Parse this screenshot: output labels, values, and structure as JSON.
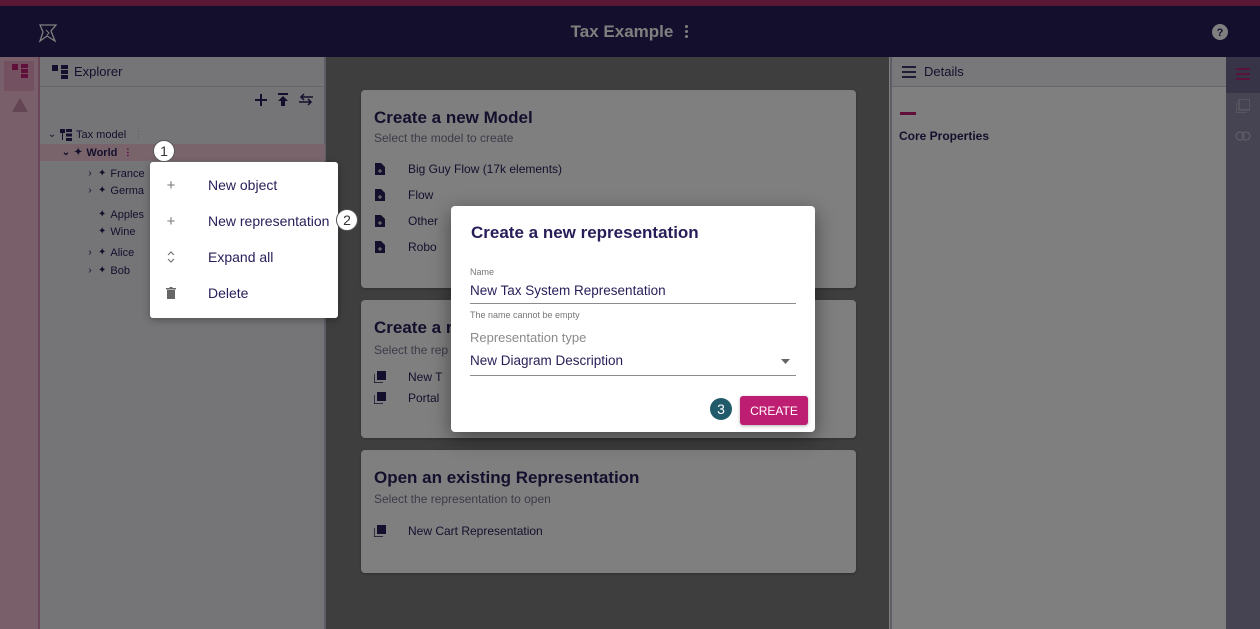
{
  "app": {
    "title": "Tax Example",
    "accent": "#be1e72",
    "header_bg": "#261e58"
  },
  "explorer": {
    "title": "Explorer",
    "tree": [
      {
        "label": "Tax model",
        "level": 0
      },
      {
        "label": "World",
        "level": 1,
        "selected": true
      },
      {
        "label": "France",
        "level": 2
      },
      {
        "label": "Germa",
        "level": 2
      },
      {
        "label": "Apples",
        "level": 2
      },
      {
        "label": "Wine",
        "level": 2
      },
      {
        "label": "Alice",
        "level": 2
      },
      {
        "label": "Bob",
        "level": 2
      }
    ]
  },
  "context_menu": {
    "items": [
      {
        "label": "New object",
        "icon": "plus-icon"
      },
      {
        "label": "New representation",
        "icon": "plus-icon"
      },
      {
        "label": "Expand all",
        "icon": "unfold-icon"
      },
      {
        "label": "Delete",
        "icon": "trash-icon"
      }
    ]
  },
  "badges": [
    "1",
    "2",
    "3"
  ],
  "main": {
    "new_model": {
      "title": "Create a new Model",
      "subtitle": "Select the model to create",
      "items": [
        "Big Guy Flow (17k elements)",
        "Flow",
        "Other",
        "Robo"
      ]
    },
    "new_representation": {
      "title": "Create a r",
      "subtitle": "Select the rep",
      "items": [
        "New T",
        "Portal"
      ]
    },
    "open_existing": {
      "title": "Open an existing Representation",
      "subtitle": "Select the representation to open",
      "items": [
        "New Cart Representation"
      ]
    }
  },
  "details": {
    "title": "Details",
    "section": "Core Properties"
  },
  "dialog": {
    "title": "Create a new representation",
    "name_label": "Name",
    "name_value": "New Tax System Representation",
    "name_helper": "The name cannot be empty",
    "type_label": "Representation type",
    "type_value": "New Diagram Description",
    "create_label": "CREATE"
  }
}
